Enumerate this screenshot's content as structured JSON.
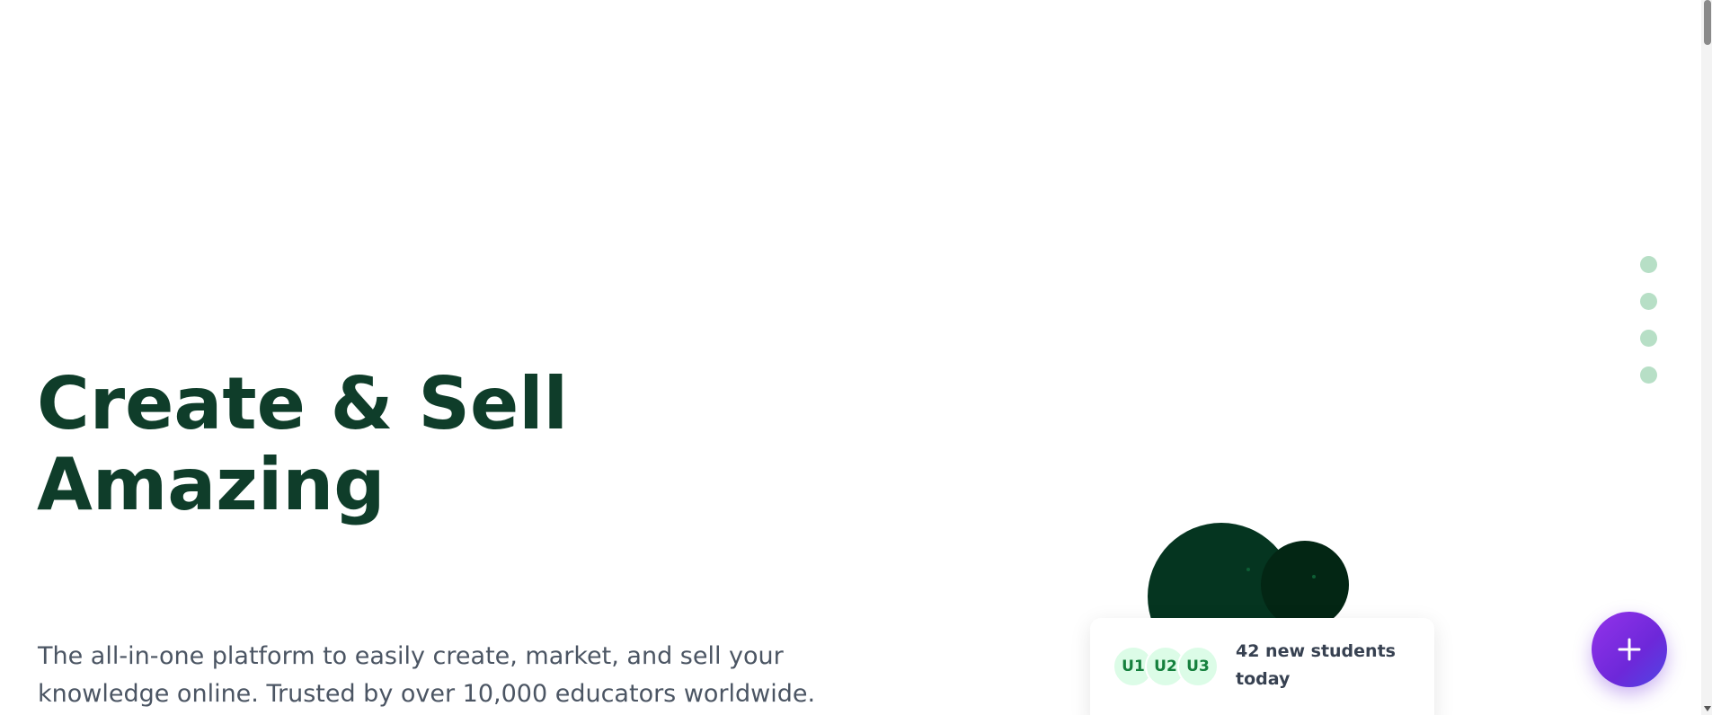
{
  "hero": {
    "title_line1": "Create & Sell",
    "title_line2": "Amazing",
    "subtitle_line1": "The all-in-one platform to easily create, market, and sell your",
    "subtitle_line2": "knowledge online. Trusted by over 10,000 educators worldwide."
  },
  "dot_nav": {
    "count": 4
  },
  "students_card": {
    "avatars": [
      "U1",
      "U2",
      "U3"
    ],
    "text": "42 new students today"
  },
  "fab": {
    "icon": "plus-icon"
  },
  "colors": {
    "title": "#0f3d2a",
    "accent_green": "#b7dfc6",
    "fab_gradient_start": "#9333ea",
    "fab_gradient_end": "#4f46e5"
  }
}
